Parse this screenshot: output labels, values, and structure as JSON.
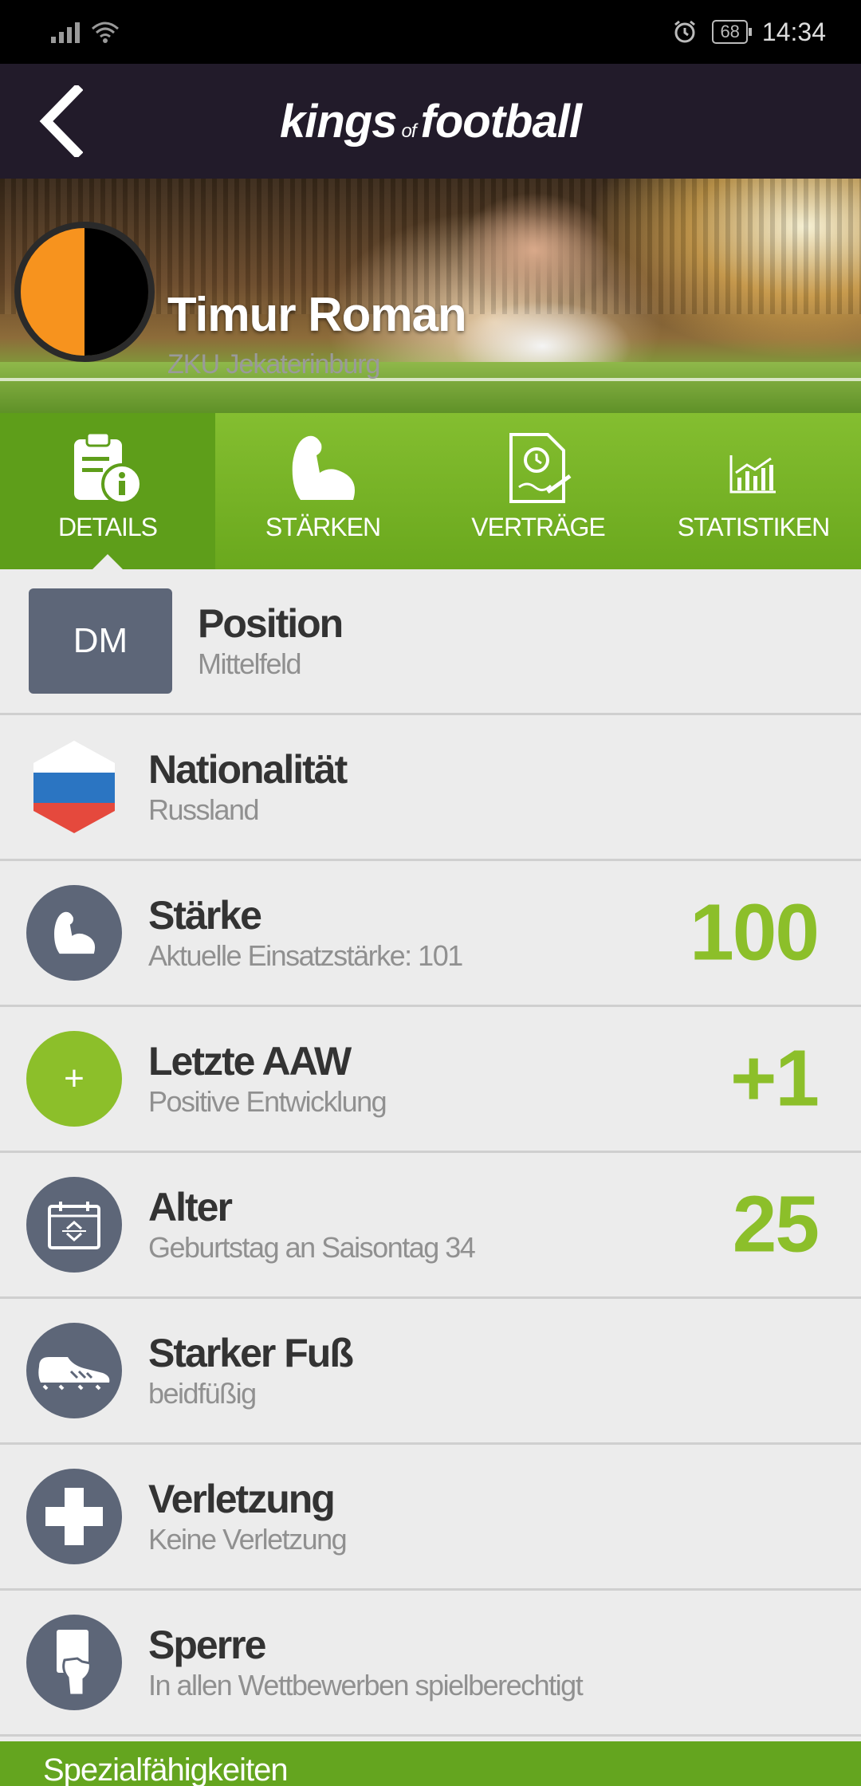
{
  "status_bar": {
    "time": "14:34",
    "battery": "68"
  },
  "header": {
    "logo_part1": "kings",
    "logo_of": "of",
    "logo_part2": "football"
  },
  "player": {
    "name": "Timur Roman",
    "club": "ZKU Jekaterinburg"
  },
  "tabs": [
    {
      "label": "DETAILS",
      "icon": "clipboard-info-icon",
      "active": true
    },
    {
      "label": "STÄRKEN",
      "icon": "bicep-icon",
      "active": false
    },
    {
      "label": "VERTRÄGE",
      "icon": "contract-icon",
      "active": false
    },
    {
      "label": "STATISTIKEN",
      "icon": "chart-icon",
      "active": false
    }
  ],
  "details": {
    "position": {
      "badge": "DM",
      "title": "Position",
      "sub": "Mittelfeld"
    },
    "nationality": {
      "title": "Nationalität",
      "sub": "Russland"
    },
    "strength": {
      "title": "Stärke",
      "sub": "Aktuelle Einsatzstärke: 101",
      "value": "100"
    },
    "last_aaw": {
      "title": "Letzte AAW",
      "sub": "Positive Entwicklung",
      "value": "+1",
      "icon_symbol": "+"
    },
    "age": {
      "title": "Alter",
      "sub": "Geburtstag an Saisontag 34",
      "value": "25"
    },
    "foot": {
      "title": "Starker Fuß",
      "sub": "beidfüßig"
    },
    "injury": {
      "title": "Verletzung",
      "sub": "Keine Verletzung"
    },
    "suspension": {
      "title": "Sperre",
      "sub": "In allen Wettbewerben spielberechtigt"
    }
  },
  "footer": {
    "label": "Spezialfähigkeiten"
  },
  "colors": {
    "accent_green": "#8cbf2a",
    "tab_green": "#6aa81d",
    "header_dark": "#221b2a",
    "icon_gray": "#5d6678"
  }
}
